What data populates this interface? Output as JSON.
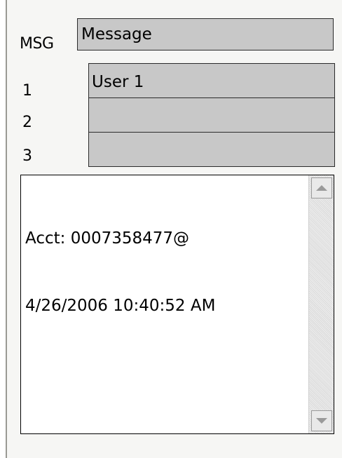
{
  "msg": {
    "label": "MSG",
    "value": "Message"
  },
  "users": [
    {
      "label": "1",
      "value": "User 1"
    },
    {
      "label": "2",
      "value": ""
    },
    {
      "label": "3",
      "value": ""
    }
  ],
  "log": {
    "line1": "Acct: 0007358477@",
    "line2": "4/26/2006 10:40:52 AM"
  },
  "scrollbar": {
    "up_icon": "scroll-up-arrow",
    "down_icon": "scroll-down-arrow"
  }
}
